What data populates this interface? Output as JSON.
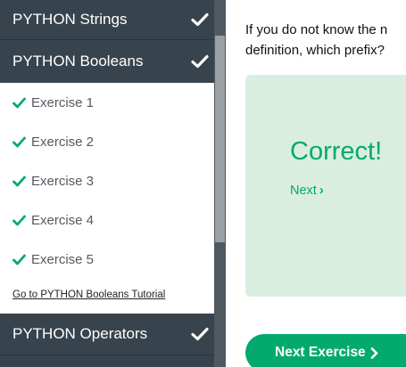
{
  "sidebar": {
    "sections": {
      "strings": {
        "label": "PYTHON Strings",
        "completed": true
      },
      "booleans": {
        "label": "PYTHON Booleans",
        "completed": true
      },
      "operators": {
        "label": "PYTHON Operators",
        "completed": true
      }
    },
    "exercises": [
      {
        "label": "Exercise 1",
        "completed": true
      },
      {
        "label": "Exercise 2",
        "completed": true
      },
      {
        "label": "Exercise 3",
        "completed": true
      },
      {
        "label": "Exercise 4",
        "completed": true
      },
      {
        "label": "Exercise 5",
        "completed": true
      }
    ],
    "tutorial_link": "Go to PYTHON Booleans Tutorial"
  },
  "main": {
    "question_line1": "If you do not know the n",
    "question_line2": "definition, which prefix?",
    "result_title": "Correct!",
    "next_link": "Next",
    "next_exercise_button": "Next Exercise"
  },
  "colors": {
    "sidebar_header": "#38444d",
    "accent_green": "#04aa6d",
    "result_background": "#d9eee1"
  },
  "icons": {
    "section_check": "check-icon",
    "exercise_check": "check-icon",
    "chevron": "chevron-right-icon"
  }
}
